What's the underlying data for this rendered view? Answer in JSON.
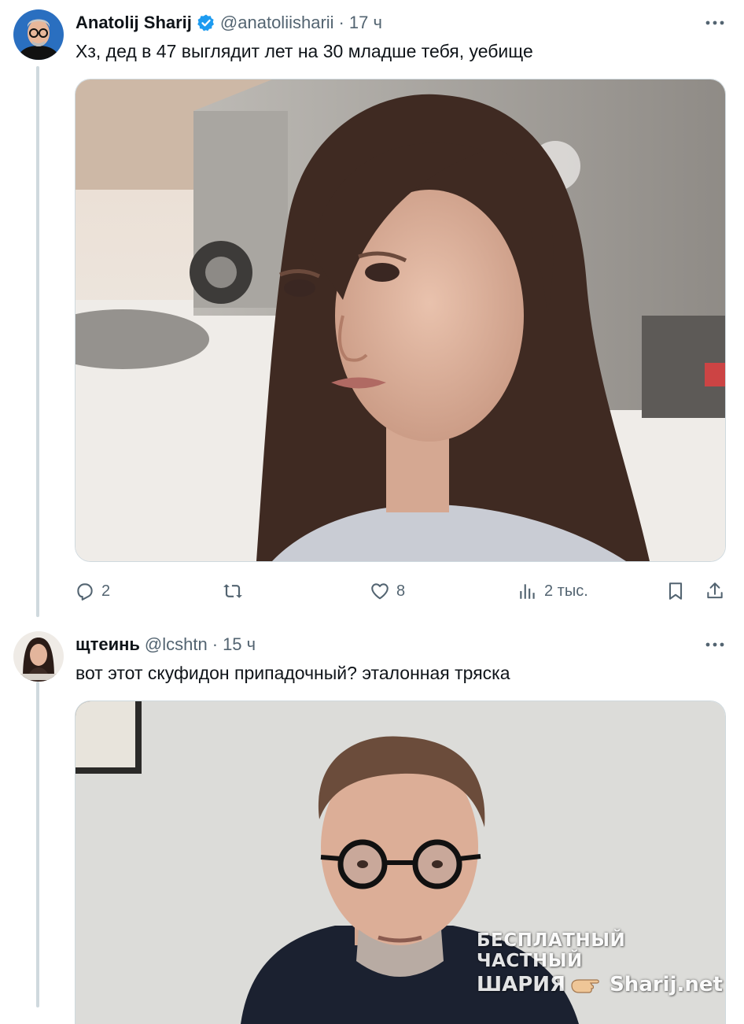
{
  "tweets": [
    {
      "name": "Anatolij Sharij",
      "handle": "@anatoliisharii",
      "separator": "·",
      "time": "17 ч",
      "text": "Хз, дед в 47 выглядит лет на 30 младше тебя, уебище",
      "media_alt": "photo-woman-street",
      "stats": {
        "replies": "2",
        "retweets": "",
        "likes": "8",
        "views": "2 тыс."
      }
    },
    {
      "name": "щтеинь",
      "handle": "@lcshtn",
      "separator": "·",
      "time": "15 ч",
      "text": "вот этот скуфидон припадочный? эталонная тряска",
      "media_alt": "photo-man-glasses"
    }
  ],
  "watermark": {
    "line1": "БЕСПЛАТНЫЙ ЧАСТНЫЙ",
    "line2_left": "ШАРИЯ",
    "line2_right": "Sharij.net"
  },
  "colors": {
    "verified": "#1d9bf0",
    "secondary_text": "#536471",
    "thread_line": "#cfd9de",
    "border": "#cfd9de"
  },
  "icons": {
    "reply": "reply-icon",
    "retweet": "retweet-icon",
    "like": "heart-icon",
    "views": "views-icon",
    "bookmark": "bookmark-icon",
    "share": "share-icon",
    "more": "more-dots-icon",
    "verified": "verified-badge-icon"
  }
}
